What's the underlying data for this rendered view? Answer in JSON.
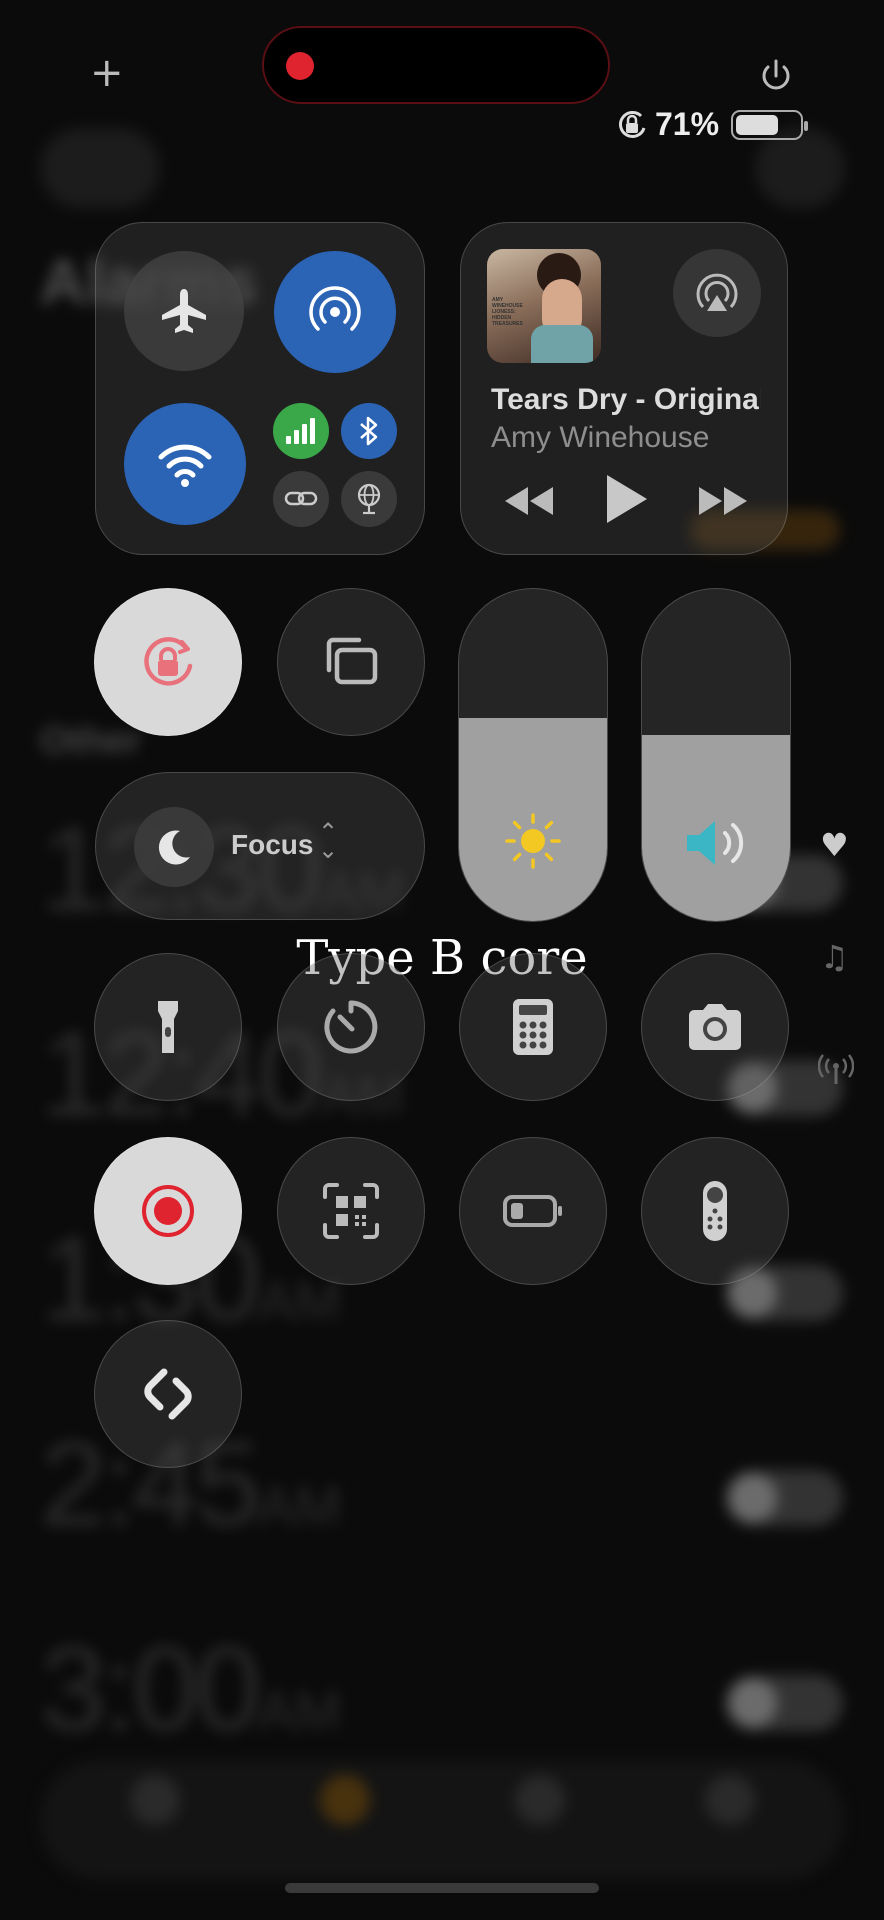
{
  "status_bar": {
    "battery_percent": "71%",
    "battery_level": 0.71,
    "recording_dot_color": "#e0242f"
  },
  "connectivity": {
    "airplane_mode": false,
    "airdrop": true,
    "cellular": true,
    "wifi": true,
    "bluetooth": true,
    "accent_color": "#2b63b5",
    "cellular_color": "#3aa849"
  },
  "now_playing": {
    "title": "Tears Dry - Original",
    "artist": "Amy Winehouse",
    "album_cover_text": "AMY WINEHOUSE LIONESS: HIDDEN TREASURES"
  },
  "focus": {
    "label": "Focus"
  },
  "sliders": {
    "brightness_level": 0.61,
    "volume_level": 0.56,
    "brightness_icon_color": "#f3c823",
    "volume_icon_color": "#3bb6c4"
  },
  "controls": {
    "orientation_lock_color": "#e8717c",
    "screen_record_color": "#e0242f",
    "tiles": [
      "orientation-lock",
      "screen-mirroring",
      "flashlight",
      "timer",
      "calculator",
      "camera",
      "screen-recording",
      "code-scanner",
      "low-power-mode",
      "apple-tv-remote",
      "shazam"
    ]
  },
  "overlay": {
    "text": "Type B core"
  },
  "background_app": {
    "title": "Alarms",
    "section": "Other",
    "alarms": [
      {
        "time": "12:30",
        "ampm": "AM"
      },
      {
        "time": "12:40",
        "ampm": "AM"
      },
      {
        "time": "1:30",
        "ampm": "AM"
      },
      {
        "time": "2:45",
        "ampm": "AM"
      },
      {
        "time": "3:00",
        "ampm": "AM"
      }
    ]
  }
}
